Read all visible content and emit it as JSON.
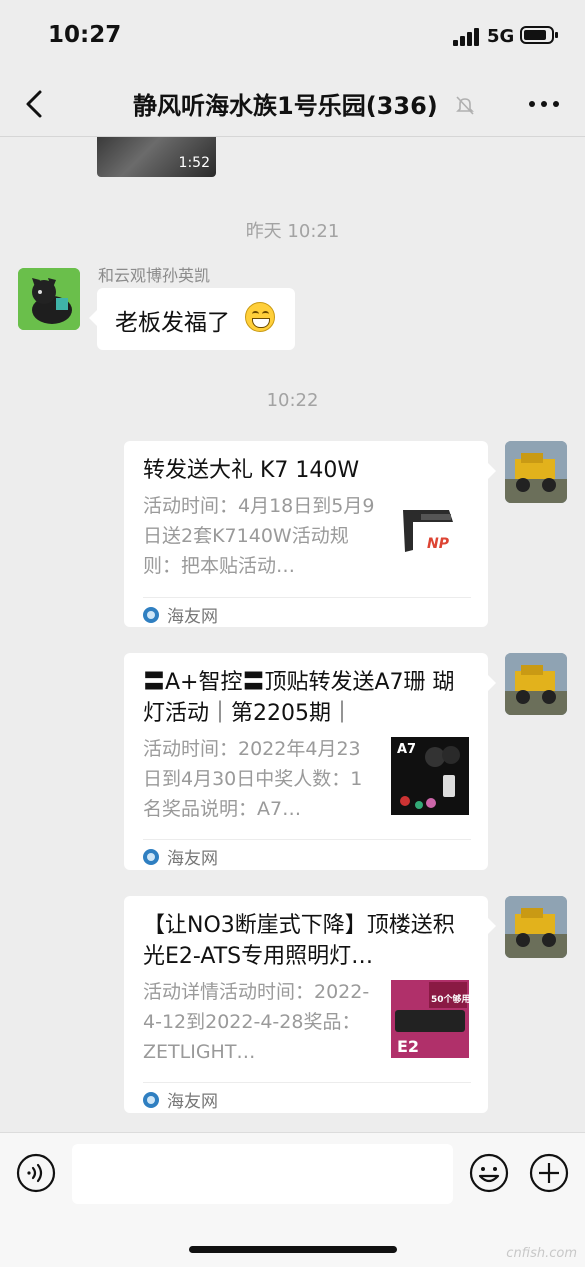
{
  "status_bar": {
    "time": "10:27",
    "network": "5G"
  },
  "nav": {
    "title": "静风听海水族1号乐园(336)"
  },
  "video": {
    "duration": "1:52"
  },
  "timestamps": {
    "yesterday": "昨天 10:21",
    "today": "10:22"
  },
  "messages": {
    "incoming": {
      "sender": "和云观博孙英凯",
      "text": "老板发福了"
    }
  },
  "cards": [
    {
      "title": "转发送大礼 K7 140W",
      "desc": "活动时间：4月18日到5月9日送2套K7140W活动规则：把本贴活动…",
      "source": "海友网",
      "thumb_label": "NP"
    },
    {
      "title": "〓A+智控〓顶贴转发送A7珊 瑚灯活动｜第2205期｜",
      "desc": "活动时间：2022年4月23日到4月30日中奖人数：1名奖品说明：A7…",
      "source": "海友网",
      "thumb_label": "A7"
    },
    {
      "title": "【让NO3断崖式下降】顶楼送积光E2-ATS专用照明灯…",
      "desc": "活动详情活动时间：2022-4-12到2022-4-28奖品：ZETLIGHT…",
      "source": "海友网",
      "thumb_label": "E2",
      "thumb_badge": "50个够用"
    }
  ],
  "watermark": "cnfish.com",
  "colors": {
    "background": "#ededed",
    "bubble": "#ffffff",
    "muted": "#9a9a9a"
  }
}
